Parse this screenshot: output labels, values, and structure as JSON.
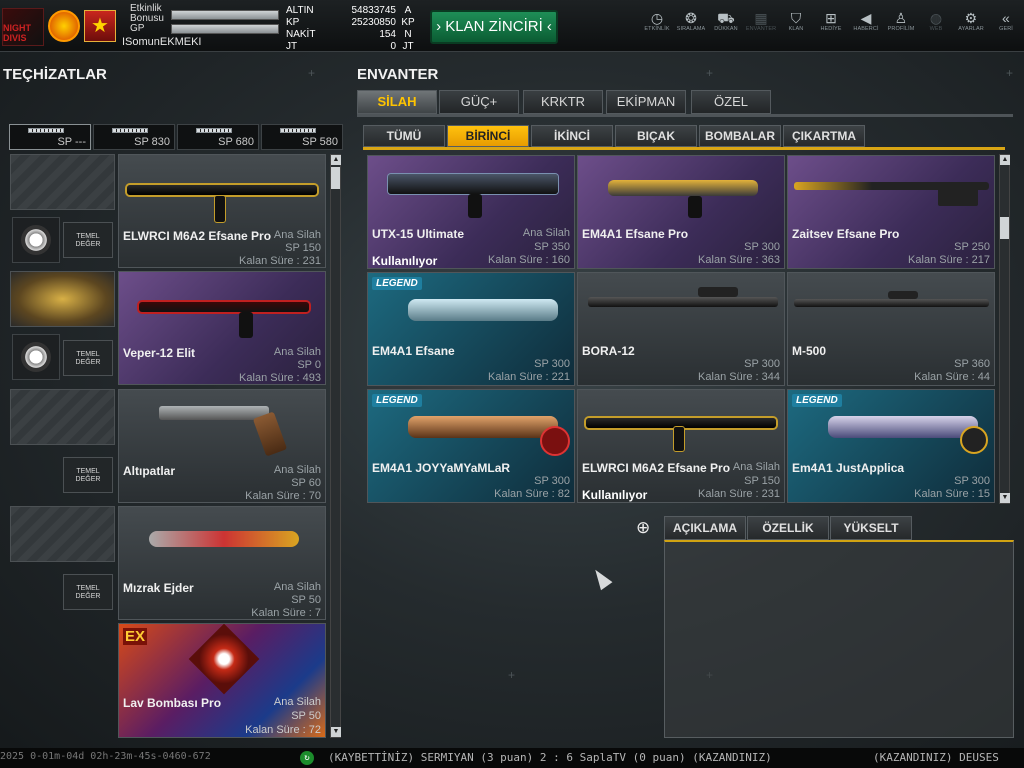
{
  "topbar": {
    "logo_text": "NIGHT DIVIS",
    "bonus_label": "Etkinlik Bonusu",
    "gp_label": "GP",
    "player_name": "ISomunEKMEKI",
    "currencies": [
      {
        "label": "ALTIN",
        "value": "54833745",
        "unit": "A"
      },
      {
        "label": "KP",
        "value": "25230850",
        "unit": "KP"
      },
      {
        "label": "NAKİT",
        "value": "154",
        "unit": "N"
      },
      {
        "label": "JT",
        "value": "0",
        "unit": "JT"
      }
    ],
    "clan_chain_label": "KLAN ZİNCİRİ",
    "nav": [
      {
        "label": "ETKİNLİK",
        "icon": "stopwatch-icon",
        "glyph": "◷"
      },
      {
        "label": "SIRALAMA",
        "icon": "medal-icon",
        "glyph": "❂"
      },
      {
        "label": "DÜKKAN",
        "icon": "cart-icon",
        "glyph": "⛟"
      },
      {
        "label": "ENVANTER",
        "icon": "inventory-icon",
        "glyph": "▦"
      },
      {
        "label": "KLAN",
        "icon": "shield-icon",
        "glyph": "⛉"
      },
      {
        "label": "HEDİYE",
        "icon": "gift-icon",
        "glyph": "⊞"
      },
      {
        "label": "HABERCİ",
        "icon": "megaphone-icon",
        "glyph": "◀"
      },
      {
        "label": "PROFİLİM",
        "icon": "profile-icon",
        "glyph": "♙"
      },
      {
        "label": "WEB",
        "icon": "globe-icon",
        "glyph": "◍"
      },
      {
        "label": "AYARLAR",
        "icon": "gear-icon",
        "glyph": "⚙"
      },
      {
        "label": "GERİ",
        "icon": "back-icon",
        "glyph": "«"
      }
    ]
  },
  "left": {
    "title": "TEÇHİZATLAR",
    "sp_tabs": [
      "SP ---",
      "SP 830",
      "SP 680",
      "SP 580"
    ],
    "temel_label": "TEMEL DEĞER",
    "items": [
      {
        "name": "ELWRCI M6A2 Efsane Pro",
        "type": "Ana Silah",
        "sp": "SP 150",
        "remain": "Kalan Süre : 231"
      },
      {
        "name": "Veper-12 Elit",
        "type": "Ana Silah",
        "sp": "SP 0",
        "remain": "Kalan Süre : 493"
      },
      {
        "name": "Altıpatlar",
        "type": "Ana Silah",
        "sp": "SP 60",
        "remain": "Kalan Süre : 70"
      },
      {
        "name": "Mızrak Ejder",
        "type": "Ana Silah",
        "sp": "SP 50",
        "remain": "Kalan Süre : 7"
      },
      {
        "name": "Lav Bombası Pro",
        "type": "Ana Silah",
        "sp": "SP 50",
        "remain": "Kalan Süre : 72",
        "badge": "EX"
      }
    ]
  },
  "right": {
    "title": "ENVANTER",
    "main_tabs": [
      "SİLAH",
      "GÜÇ+",
      "KRKTR",
      "EKİPMAN",
      "ÖZEL"
    ],
    "sub_tabs": [
      "TÜMÜ",
      "BİRİNCİ",
      "İKİNCİ",
      "BIÇAK",
      "BOMBALAR",
      "ÇIKARTMA"
    ],
    "in_use_label": "Kullanılıyor",
    "legend_label": "LEGEND",
    "inventory": [
      {
        "name": "UTX-15 Ultimate",
        "type": "Ana Silah",
        "sp": "SP 350",
        "remain": "Kalan Süre : 160",
        "in_use": true,
        "legend": false
      },
      {
        "name": "EM4A1 Efsane Pro",
        "type": "",
        "sp": "SP 300",
        "remain": "Kalan Süre : 363",
        "in_use": false,
        "legend": false
      },
      {
        "name": "Zaitsev Efsane Pro",
        "type": "",
        "sp": "SP 250",
        "remain": "Kalan Süre : 217",
        "in_use": false,
        "legend": false
      },
      {
        "name": "EM4A1 Efsane",
        "type": "",
        "sp": "SP 300",
        "remain": "Kalan Süre : 221",
        "in_use": false,
        "legend": true
      },
      {
        "name": "BORA-12",
        "type": "",
        "sp": "SP 300",
        "remain": "Kalan Süre : 344",
        "in_use": false,
        "legend": false
      },
      {
        "name": "M-500",
        "type": "",
        "sp": "SP 360",
        "remain": "Kalan Süre : 44",
        "in_use": false,
        "legend": false
      },
      {
        "name": "EM4A1 JOYYaMYaMLaR",
        "type": "",
        "sp": "SP 300",
        "remain": "Kalan Süre : 82",
        "in_use": false,
        "legend": true
      },
      {
        "name": "ELWRCI M6A2 Efsane Pro",
        "type": "Ana Silah",
        "sp": "SP 150",
        "remain": "Kalan Süre : 231",
        "in_use": true,
        "legend": false
      },
      {
        "name": "Em4A1 JustApplica",
        "type": "",
        "sp": "SP 300",
        "remain": "Kalan Süre : 15",
        "in_use": false,
        "legend": true
      }
    ],
    "info_tabs": [
      "AÇIKLAMA",
      "ÖZELLİK",
      "YÜKSELT"
    ]
  },
  "statusbar": {
    "left_text": "2025 0-01m-04d 02h-23m-45s-0460-672",
    "ticker": "(KAYBETTİNİZ) SERMIYAN (3 puan) 2 : 6 SaplaTV (0 puan) (KAZANDINIZ)",
    "ticker_right": "(KAZANDINIZ) DEUSES"
  },
  "colors": {
    "accent": "#ffc20e",
    "clan_green": "#1e8f57",
    "card_purple": "#5a3f78"
  }
}
